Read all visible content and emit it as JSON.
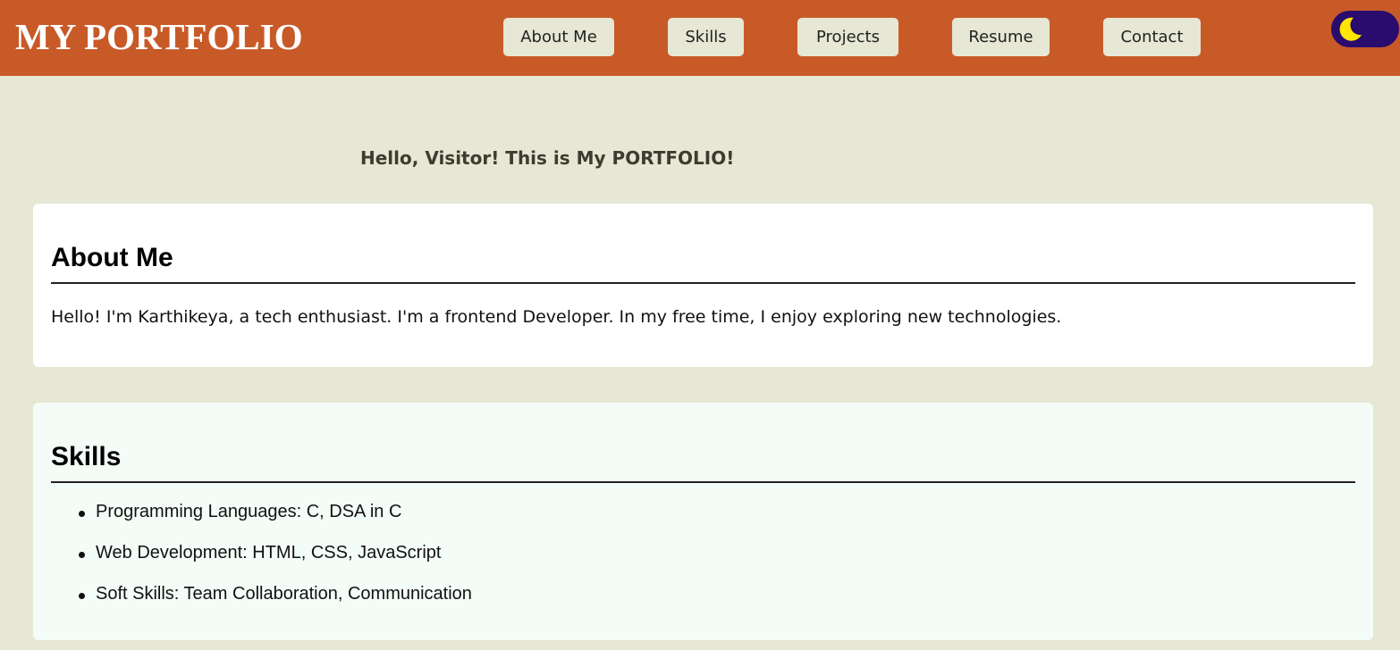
{
  "header": {
    "brand": "MY PORTFOLIO",
    "nav": [
      {
        "label": "About Me"
      },
      {
        "label": "Skills"
      },
      {
        "label": "Projects"
      },
      {
        "label": "Resume"
      },
      {
        "label": "Contact"
      }
    ],
    "theme_toggle_icon": "moon-icon"
  },
  "greeting": "Hello, Visitor! This is My PORTFOLIO!",
  "about": {
    "title": "About Me",
    "text": "Hello! I'm Karthikeya, a tech enthusiast. I'm a frontend Developer. In my free time, I enjoy exploring new technologies."
  },
  "skills": {
    "title": "Skills",
    "items": [
      "Programming Languages: C, DSA in C",
      "Web Development: HTML, CSS, JavaScript",
      "Soft Skills: Team Collaboration, Communication"
    ]
  },
  "colors": {
    "header_bg": "#c85a28",
    "page_bg": "#e6e7d4",
    "toggle_bg": "#2a0b6e",
    "moon": "#ffe600"
  }
}
